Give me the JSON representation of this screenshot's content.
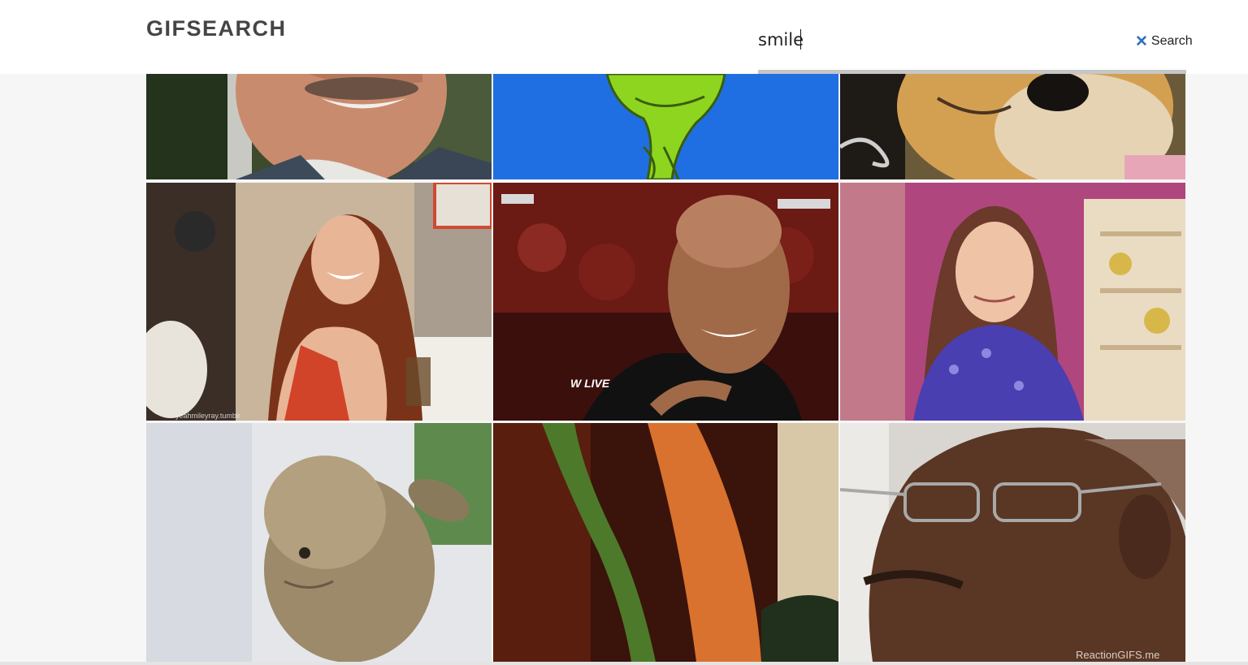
{
  "app": {
    "logo_text": "GIFSEARCH"
  },
  "search": {
    "value": "smile",
    "button_label": "Search",
    "clear_icon": "close-icon"
  },
  "results": [
    {
      "name": "gif-man-mustache-smile"
    },
    {
      "name": "gif-grinch-smile"
    },
    {
      "name": "gif-doge-smile"
    },
    {
      "name": "gif-girl-red-hair-smile",
      "watermark": "yeahmileyray.tumblr"
    },
    {
      "name": "gif-wrestler-smile"
    },
    {
      "name": "gif-little-girl-smile"
    },
    {
      "name": "gif-bunny-smile"
    },
    {
      "name": "gif-carrot-scene"
    },
    {
      "name": "gif-man-glasses-smile",
      "watermark": "ReactionGIFS.me"
    }
  ],
  "colors": {
    "accent": "#2f6fbf",
    "header_bg": "#ffffff",
    "page_bg": "#f6f6f6",
    "logo": "#454545"
  }
}
